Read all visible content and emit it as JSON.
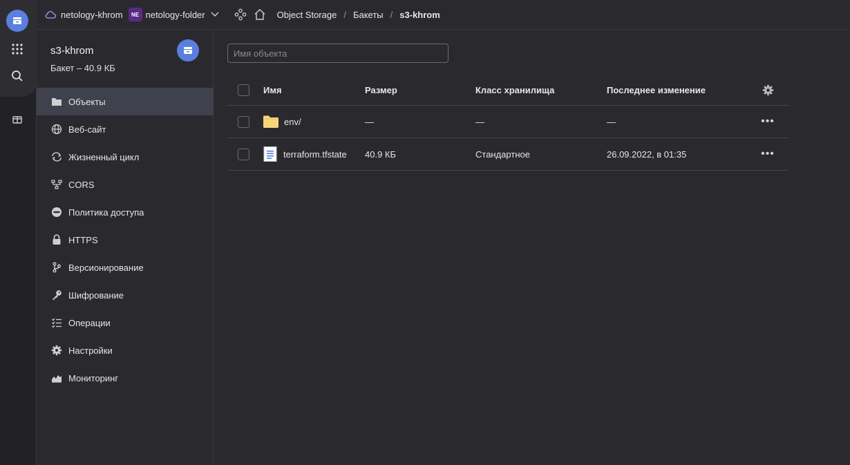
{
  "topbar": {
    "cloud_label": "netology-khrom",
    "folder_badge": "NE",
    "folder_label": "netology-folder",
    "service_label": "Object Storage",
    "breadcrumb_sep": "/",
    "buckets_label": "Бакеты",
    "current_label": "s3-khrom"
  },
  "bucket": {
    "name": "s3-khrom",
    "info": "Бакет – 40.9 КБ"
  },
  "nav": {
    "items": [
      {
        "label": "Объекты",
        "icon": "folder-icon",
        "active": true
      },
      {
        "label": "Веб-сайт",
        "icon": "globe-icon"
      },
      {
        "label": "Жизненный цикл",
        "icon": "cycle-icon"
      },
      {
        "label": "CORS",
        "icon": "cors-icon"
      },
      {
        "label": "Политика доступа",
        "icon": "no-entry-icon"
      },
      {
        "label": "HTTPS",
        "icon": "lock-icon"
      },
      {
        "label": "Версионирование",
        "icon": "branch-icon"
      },
      {
        "label": "Шифрование",
        "icon": "key-icon"
      },
      {
        "label": "Операции",
        "icon": "checklist-icon"
      },
      {
        "label": "Настройки",
        "icon": "gear-icon"
      },
      {
        "label": "Мониторинг",
        "icon": "chart-icon"
      }
    ]
  },
  "search": {
    "placeholder": "Имя объекта",
    "value": ""
  },
  "table": {
    "headers": {
      "name": "Имя",
      "size": "Размер",
      "class": "Класс хранилища",
      "modified": "Последнее изменение"
    },
    "rows": [
      {
        "name": "env/",
        "size": "—",
        "class": "—",
        "modified": "—",
        "type": "folder"
      },
      {
        "name": "terraform.tfstate",
        "size": "40.9 КБ",
        "class": "Стандартное",
        "modified": "26.09.2022, в 01:35",
        "type": "file"
      }
    ],
    "row_menu": "•••"
  },
  "colors": {
    "accent": "#5b7fe0",
    "background": "#2a2a2e",
    "folder": "#f5d67b"
  }
}
